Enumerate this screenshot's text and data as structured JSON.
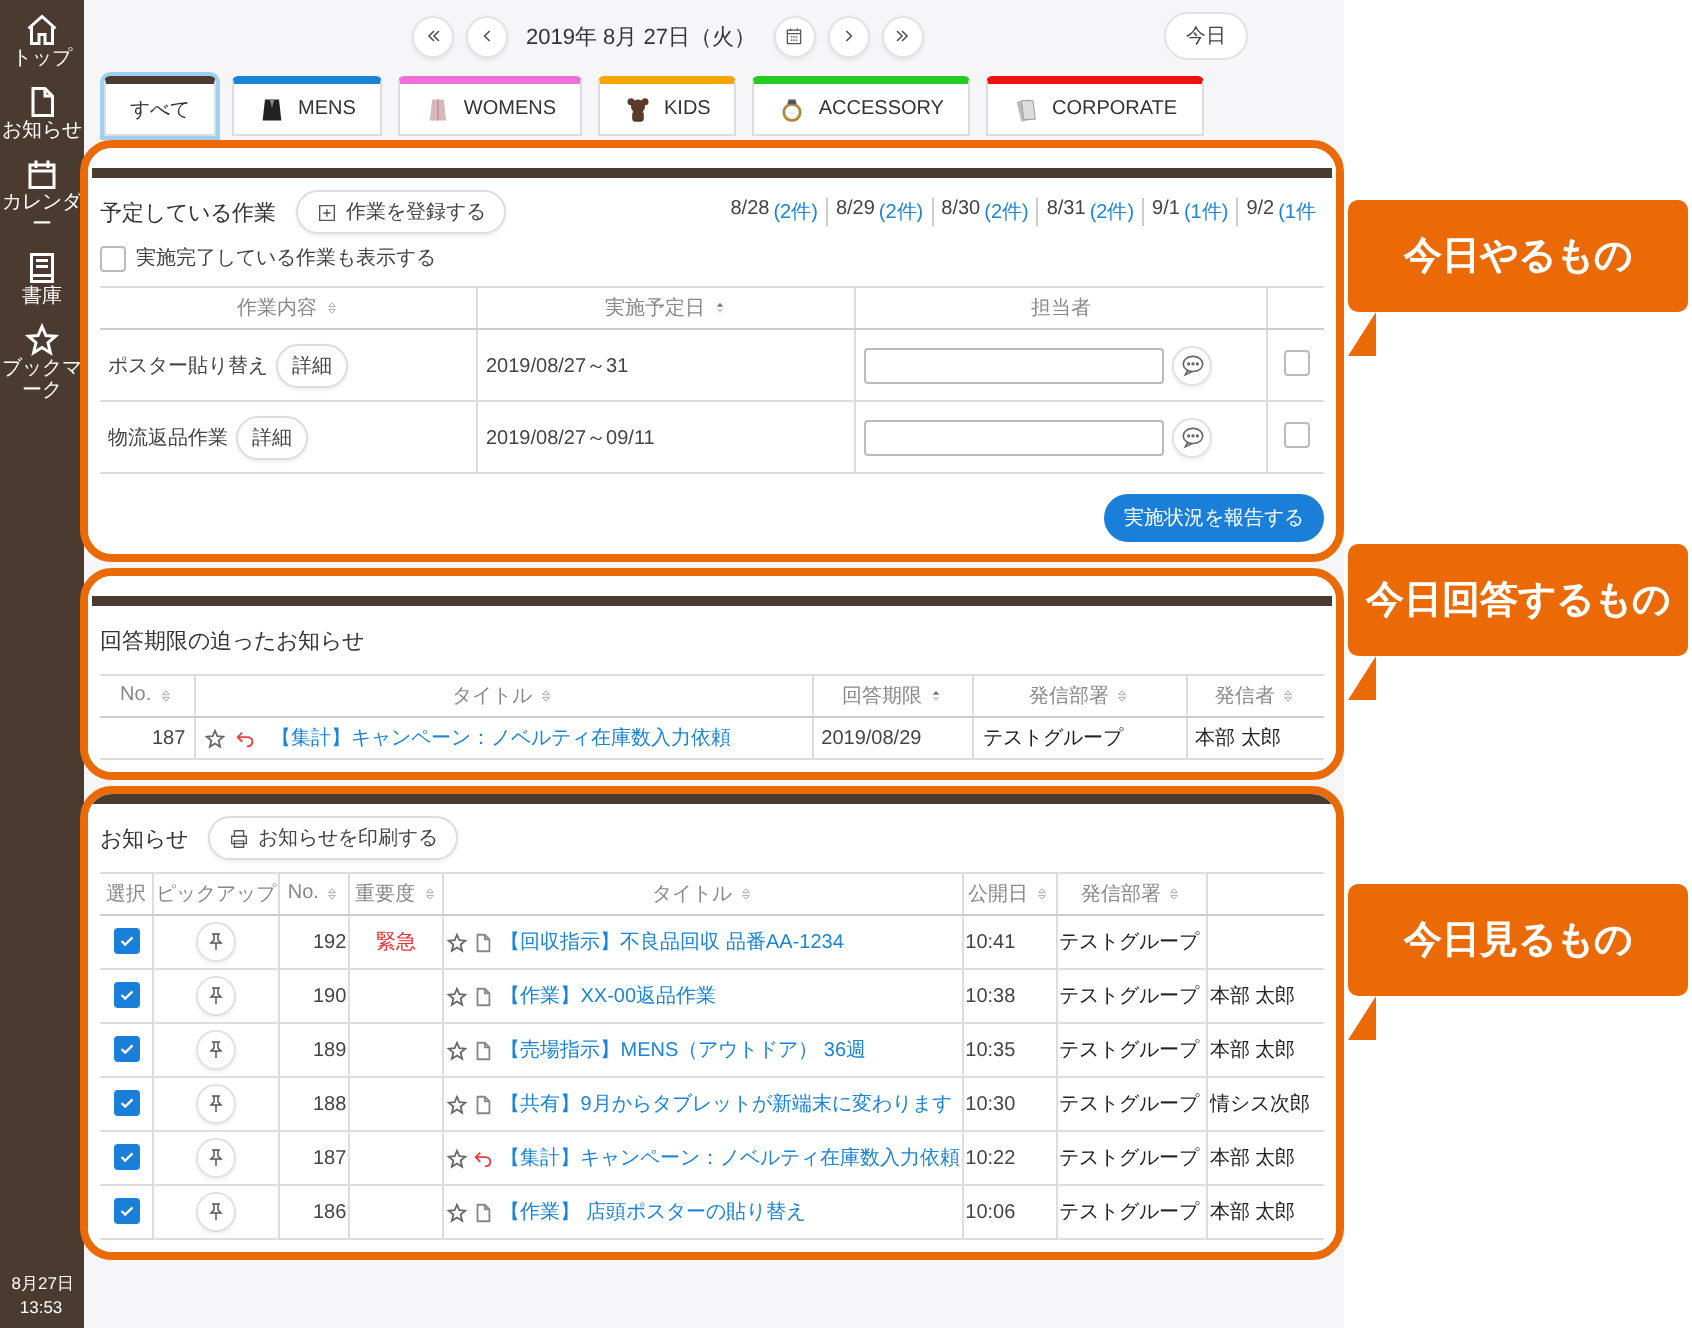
{
  "sidebar": {
    "items": [
      {
        "label": "トップ",
        "kind": "home"
      },
      {
        "label": "お知らせ",
        "kind": "document"
      },
      {
        "label": "カレンダー",
        "kind": "calendar"
      },
      {
        "label": "書庫",
        "kind": "book"
      },
      {
        "label": "ブックマーク",
        "kind": "star"
      }
    ],
    "date": "8月27日",
    "time": "13:53"
  },
  "date_nav": {
    "date": "2019年 8月 27日（火）",
    "today_button": "今日"
  },
  "tabs": [
    {
      "label": "すべて",
      "kind": "none",
      "color": "#4a3a30",
      "selected": true
    },
    {
      "label": "MENS",
      "kind": "suit",
      "color": "#1a84d6",
      "selected": false
    },
    {
      "label": "WOMENS",
      "kind": "coat",
      "color": "#f06fd6",
      "selected": false
    },
    {
      "label": "KIDS",
      "kind": "bear",
      "color": "#f5a500",
      "selected": false
    },
    {
      "label": "ACCESSORY",
      "kind": "ring",
      "color": "#22cc22",
      "selected": false
    },
    {
      "label": "CORPORATE",
      "kind": "papers",
      "color": "#ee1111",
      "selected": false
    }
  ],
  "tasks": {
    "title": "予定している作業",
    "register_button": "作業を登録する",
    "day_counts": [
      {
        "date": "8/28",
        "count": "(2件)"
      },
      {
        "date": "8/29",
        "count": "(2件)"
      },
      {
        "date": "8/30",
        "count": "(2件)"
      },
      {
        "date": "8/31",
        "count": "(2件)"
      },
      {
        "date": "9/1",
        "count": "(1件)"
      },
      {
        "date": "9/2",
        "count": "(1件"
      }
    ],
    "show_completed": {
      "label": "実施完了している作業も表示する",
      "checked": false
    },
    "columns": [
      {
        "label": "作業内容",
        "sorted": false
      },
      {
        "label": "実施予定日",
        "sorted": true
      },
      {
        "label": "担当者"
      }
    ],
    "rows": [
      {
        "task": "ポスター貼り替え",
        "detail_button": "詳細",
        "period": "2019/08/27～31",
        "done": false
      },
      {
        "task": "物流返品作業",
        "detail_button": "詳細",
        "period": "2019/08/27～09/11",
        "done": false
      }
    ],
    "report_button": "実施状況を報告する"
  },
  "deadline_notices": {
    "title": "回答期限の迫ったお知らせ",
    "columns": [
      {
        "label": "No.",
        "sorted": false
      },
      {
        "label": "タイトル",
        "sorted": false
      },
      {
        "label": "回答期限",
        "sorted": true
      },
      {
        "label": "発信部署",
        "sorted": false
      },
      {
        "label": "発信者",
        "sorted": false
      }
    ],
    "rows": [
      {
        "no": "187",
        "kind": "reply",
        "title": "【集計】キャンペーン：ノベルティ在庫数入力依頼",
        "deadline": "2019/08/29",
        "department": "テストグループ",
        "sender": "本部 太郎"
      }
    ]
  },
  "notices": {
    "title": "お知らせ",
    "print_button": "お知らせを印刷する",
    "columns": [
      {
        "label": "選択"
      },
      {
        "label": "ピックアップ"
      },
      {
        "label": "No.",
        "sorted": false
      },
      {
        "label": "重要度",
        "sorted": false
      },
      {
        "label": "タイトル",
        "sorted": false
      },
      {
        "label": "公開日",
        "sorted": false
      },
      {
        "label": "発信部署",
        "sorted": false
      },
      {}
    ],
    "rows": [
      {
        "selected": true,
        "no": "192",
        "priority": "緊急",
        "kind": "document",
        "title": "【回収指示】不良品回収 品番AA-1234",
        "published": "10:41",
        "department": "テストグループ"
      },
      {
        "selected": true,
        "no": "190",
        "kind": "document",
        "title": "【作業】XX-00返品作業",
        "published": "10:38",
        "department": "テストグループ",
        "sender": "本部 太郎"
      },
      {
        "selected": true,
        "no": "189",
        "kind": "document",
        "title": "【売場指示】MENS（アウトドア） 36週",
        "published": "10:35",
        "department": "テストグループ",
        "sender": "本部 太郎"
      },
      {
        "selected": true,
        "no": "188",
        "kind": "document",
        "title": "【共有】9月からタブレットが新端末に変わります",
        "published": "10:30",
        "department": "テストグループ",
        "sender": "情シス次郎"
      },
      {
        "selected": true,
        "no": "187",
        "kind": "reply",
        "title": "【集計】キャンペーン：ノベルティ在庫数入力依頼",
        "published": "10:22",
        "department": "テストグループ",
        "sender": "本部 太郎"
      },
      {
        "selected": true,
        "no": "186",
        "kind": "document",
        "title": "【作業】 店頭ポスターの貼り替え",
        "published": "10:06",
        "department": "テストグループ",
        "sender": "本部 太郎"
      }
    ]
  },
  "callouts": [
    "今日やるもの",
    "今日回答するもの",
    "今日見るもの"
  ]
}
